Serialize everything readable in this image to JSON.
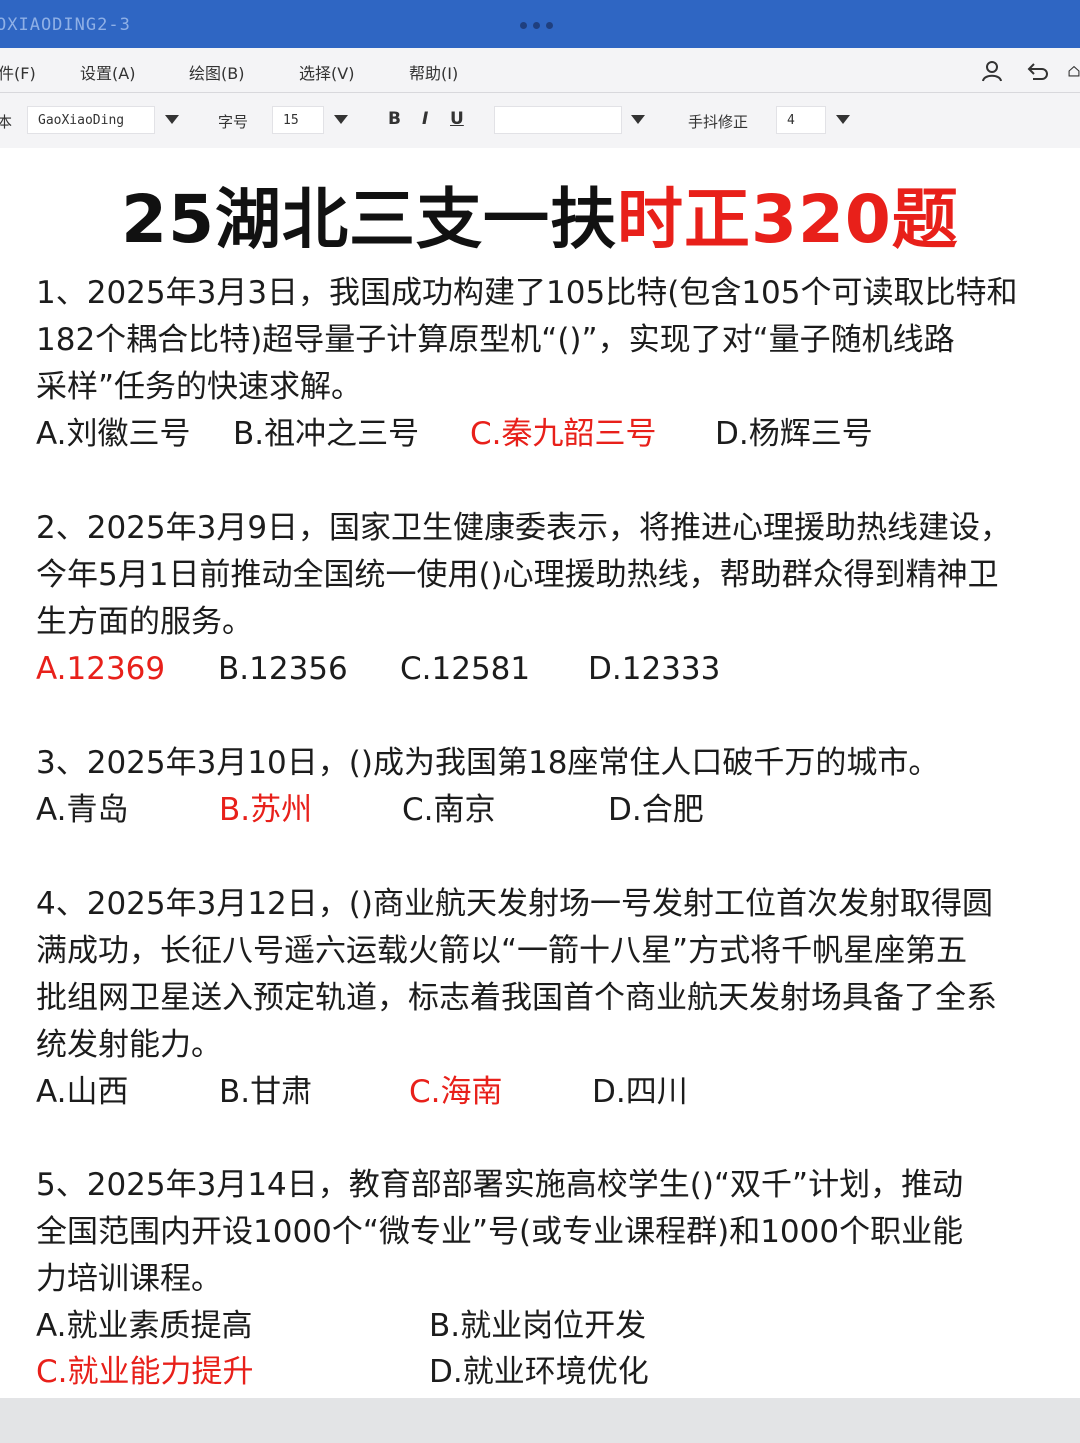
{
  "window": {
    "title": "OXIAODING2-3"
  },
  "menu": {
    "file": "件(F)",
    "settings": "设置(A)",
    "draw": "绘图(B)",
    "select": "选择(V)",
    "help": "帮助(I)"
  },
  "toolbar": {
    "font_label": "本",
    "font_value": "GaoXiaoDing",
    "size_label": "字号",
    "size_value": "15",
    "bold": "B",
    "italic": "I",
    "underline": "U",
    "color_value": "",
    "correction_label": "手抖修正",
    "correction_value": "4"
  },
  "icons": {
    "user": "user-icon",
    "undo": "undo-icon",
    "home": "home-icon"
  },
  "colors": {
    "title_bar": "#2f66c3",
    "answer": "#e8201a"
  },
  "title": {
    "black": "25湖北三支一扶",
    "red": "时正320题"
  },
  "questions": [
    {
      "lines": [
        "1、2025年3月3日，我国成功构建了105比特(包含105个可读取比特和",
        "182个耦合比特)超导量子计算原型机“()”，实现了对“量子随机线路",
        "采样”任务的快速求解。"
      ],
      "options": [
        "A.刘徽三号",
        "B.祖冲之三号",
        "C.秦九韶三号",
        "D.杨辉三号"
      ],
      "answer": 2
    },
    {
      "lines": [
        "2、2025年3月9日，国家卫生健康委表示，将推进心理援助热线建设，",
        "今年5月1日前推动全国统一使用()心理援助热线，帮助群众得到精神卫",
        "生方面的服务。"
      ],
      "options": [
        "A.12369",
        "B.12356",
        "C.12581",
        "D.12333"
      ],
      "answer": 0
    },
    {
      "lines": [
        "3、2025年3月10日，()成为我国第18座常住人口破千万的城市。"
      ],
      "options": [
        "A.青岛",
        "B.苏州",
        "C.南京",
        "D.合肥"
      ],
      "answer": 1
    },
    {
      "lines": [
        "4、2025年3月12日，()商业航天发射场一号发射工位首次发射取得圆",
        "满成功，长征八号遥六运载火箭以“一箭十八星”方式将千帆星座第五",
        "批组网卫星送入预定轨道，标志着我国首个商业航天发射场具备了全系",
        "统发射能力。"
      ],
      "options": [
        "A.山西",
        "B.甘肃",
        "C.海南",
        "D.四川"
      ],
      "answer": 2
    },
    {
      "lines": [
        "5、2025年3月14日，教育部部署实施高校学生()“双千”计划，推动",
        "全国范围内开设1000个“微专业”号(或专业课程群)和1000个职业能",
        "力培训课程。"
      ],
      "options": [
        "A.就业素质提高",
        "B.就业岗位开发",
        "C.就业能力提升",
        "D.就业环境优化"
      ],
      "answer": 2
    }
  ]
}
